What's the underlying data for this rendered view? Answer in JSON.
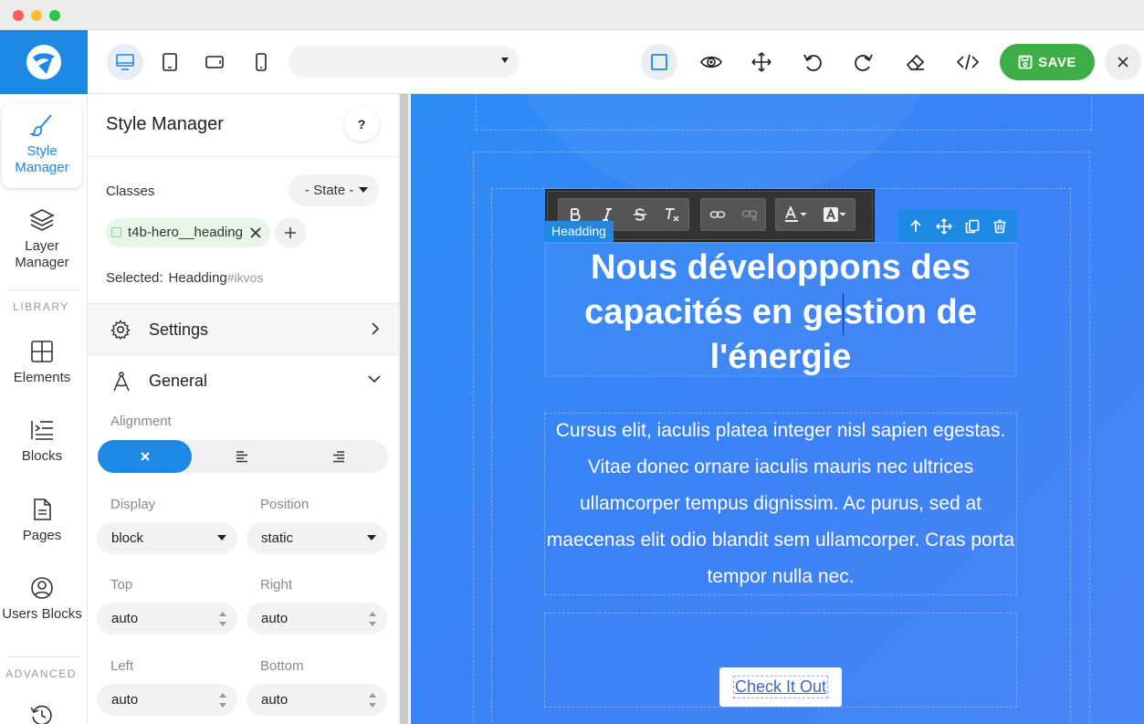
{
  "toolbar": {
    "device_select_value": "",
    "save_label": "SAVE"
  },
  "rail": {
    "style_manager": "Style Manager",
    "layer_manager": "Layer Manager",
    "library_section": "LIBRARY",
    "elements": "Elements",
    "blocks": "Blocks",
    "pages": "Pages",
    "users_blocks": "Users Blocks",
    "advanced_section": "ADVANCED"
  },
  "panel": {
    "title": "Style Manager",
    "help": "?",
    "classes_label": "Classes",
    "state_value": "- State -",
    "class_tag": "t4b-hero__heading",
    "selected_label": "Selected:",
    "selected_name": "Headding",
    "selected_id": "#ikvos",
    "settings_label": "Settings",
    "general_label": "General",
    "alignment_label": "Alignment",
    "display_label": "Display",
    "display_value": "block",
    "position_label": "Position",
    "position_value": "static",
    "top_label": "Top",
    "top_value": "auto",
    "right_label": "Right",
    "right_value": "auto",
    "left_label": "Left",
    "left_value": "auto",
    "bottom_label": "Bottom",
    "bottom_value": "auto"
  },
  "canvas": {
    "badge": "Headding",
    "heading_line1": "Nous développons des",
    "heading_line2a": "capacités en ge",
    "heading_line2b": "stion de",
    "heading_line3": "l'énergie",
    "body_text": "Cursus elit, iaculis platea integer nisl sapien egestas. Vitae donec ornare iaculis mauris nec ultrices ullamcorper tempus dignissim. Ac purus, sed at maecenas elit odio blandit sem ullamcorper. Cras porta tempor nulla nec.",
    "cta": "Check It Out"
  },
  "colors": {
    "brand": "#1e88e5",
    "save": "#3eae49",
    "canvas_bg": "#3b82f6"
  }
}
